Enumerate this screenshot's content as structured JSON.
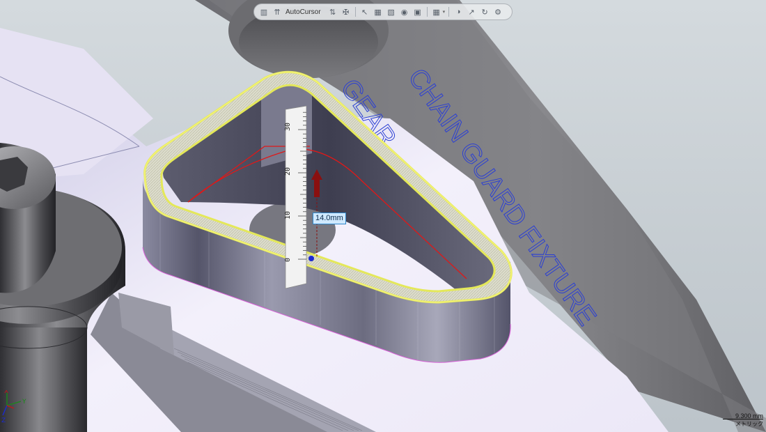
{
  "toolbar": {
    "autocursor_label": "AutoCursor",
    "icons": [
      "lock-icon",
      "autocursor-icon",
      "xyz-icon",
      "snap-icon",
      "select-icon",
      "view-icon",
      "view-icon",
      "display-style-icon",
      "section-icon",
      "grid-icon",
      "appearance-icon",
      "cursor-icon",
      "rotate-icon",
      "settings-icon"
    ]
  },
  "measurement": {
    "value_label": "14.0mm",
    "ruler_ticks": [
      "0",
      "10",
      "20",
      "30"
    ]
  },
  "engraving": {
    "line1": "CHAIN GUARD FIXTURE",
    "line2": "GEAR"
  },
  "scale": {
    "value": "9.300 mm",
    "unit_label": "メトリック"
  },
  "triad": {
    "x": "X",
    "y": "Y",
    "z": "Z"
  },
  "colors": {
    "selection_highlight": "#e4e85a",
    "ruler_arrow": "#8a1010",
    "profile_line": "#d22020",
    "engraving_text": "#2b3fd4",
    "base_plate": "#eeeaf8"
  }
}
